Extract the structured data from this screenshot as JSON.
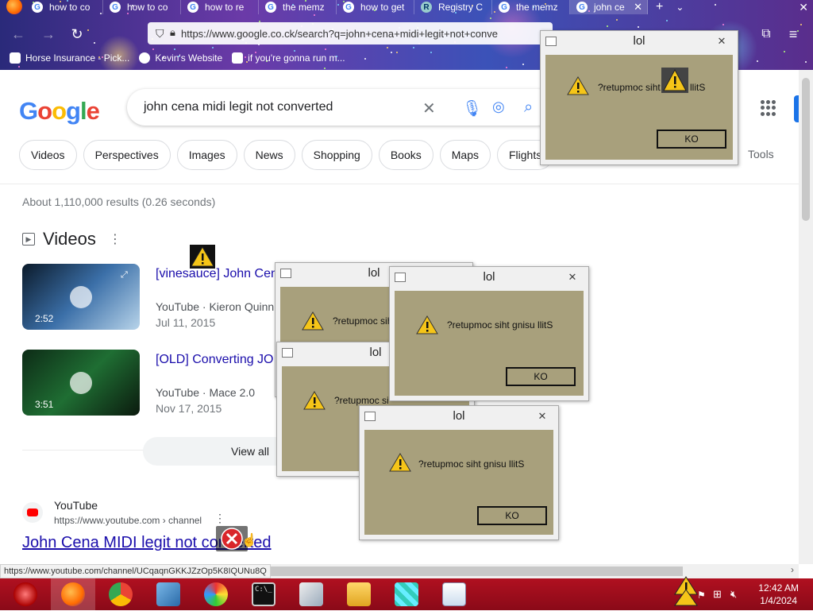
{
  "browser": {
    "tabs": [
      {
        "label": "how to co"
      },
      {
        "label": "how to co"
      },
      {
        "label": "how to re"
      },
      {
        "label": "the memz"
      },
      {
        "label": "how to get"
      },
      {
        "label": "Registry C"
      },
      {
        "label": "the memz"
      },
      {
        "label": "john ce"
      }
    ],
    "url": "https://www.google.co.ck/search?q=john+cena+midi+legit+not+conve",
    "bookmarks": [
      {
        "label": "Horse Insurance - Pick..."
      },
      {
        "label": "Kevin's Website"
      },
      {
        "label": "if you're gonna run m..."
      }
    ]
  },
  "google": {
    "logo": "Google",
    "query": "john cena midi legit not converted",
    "chips": [
      "Videos",
      "Perspectives",
      "Images",
      "News",
      "Shopping",
      "Books",
      "Maps",
      "Flights"
    ],
    "tools": "Tools",
    "stats": "About 1,110,000 results (0.26 seconds)",
    "videos_heading": "Videos",
    "videos": [
      {
        "title": "[vinesauce] John Cen",
        "source": "YouTube · Kieron Quinn",
        "date": "Jul 11, 2015",
        "duration": "2:52"
      },
      {
        "title": "[OLD] Converting JO",
        "source": "YouTube · Mace 2.0",
        "date": "Nov 17, 2015",
        "duration": "3:51"
      }
    ],
    "view_all": "View all",
    "result": {
      "site": "YouTube",
      "url": "https://www.youtube.com › channel",
      "title": "John Cena MIDI legit not converted"
    },
    "status_url": "https://www.youtube.com/channel/UCqaqnGKKJZzOp5K8IQUNu8Q"
  },
  "dialogs": {
    "title": "lol",
    "message": "?retupmoc siht gnisu llitS",
    "message_partial_1": "?retupmoc siht",
    "message_partial_2": "llitS",
    "message_partial_3": "?retupmoc sih",
    "message_partial_4": "?retupmoc si",
    "ok_label": "KO",
    "close_glyph": "✕"
  },
  "taskbar": {
    "time": "12:42 AM",
    "date": "1/4/2024"
  },
  "colors": {
    "dialog_body": "#a8a07c",
    "taskbar": "#b01020",
    "link": "#1a0dab"
  }
}
